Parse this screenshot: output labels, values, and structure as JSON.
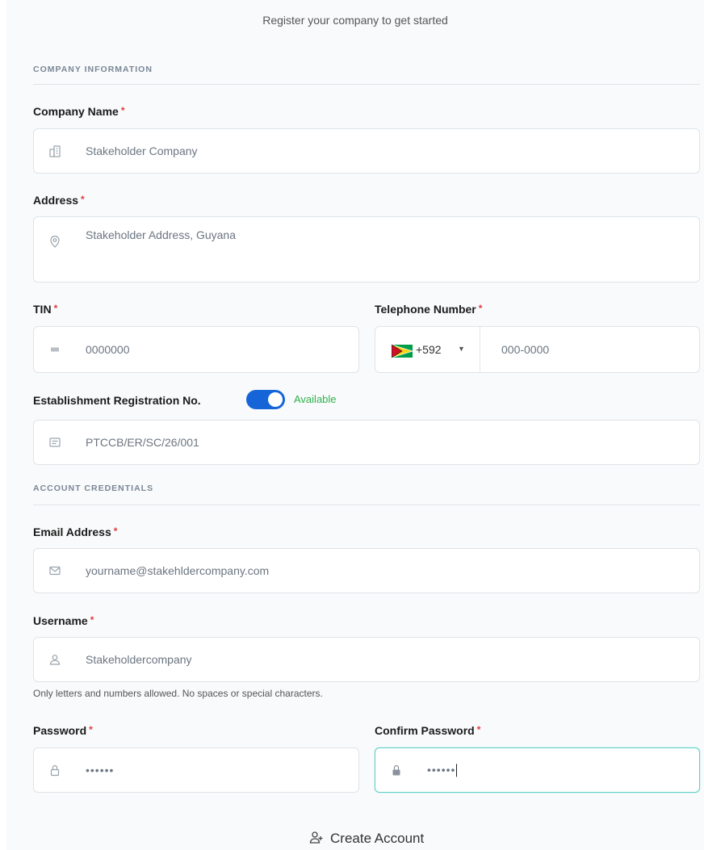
{
  "header": {
    "subtitle": "Register your company to get started"
  },
  "sections": {
    "company_info": "COMPANY INFORMATION",
    "credentials": "ACCOUNT CREDENTIALS"
  },
  "required_mark": "*",
  "fields": {
    "company_name": {
      "label": "Company Name",
      "value": "Stakeholder Company",
      "icon": "building-icon"
    },
    "address": {
      "label": "Address",
      "value": "Stakeholder Address, Guyana",
      "icon": "location-pin-icon"
    },
    "tin": {
      "label": "TIN",
      "placeholder": "0000000",
      "icon": "id-card-icon"
    },
    "telephone": {
      "label": "Telephone Number",
      "country_code": "+592",
      "placeholder": "000-0000",
      "flag": "guyana-flag-icon"
    },
    "establishment": {
      "label": "Establishment Registration No.",
      "toggle_on": true,
      "toggle_status": "Available",
      "value": "PTCCB/ER/SC/26/001",
      "icon": "document-icon"
    },
    "email": {
      "label": "Email Address",
      "value": "yourname@stakehldercompany.com",
      "icon": "mail-icon"
    },
    "username": {
      "label": "Username",
      "value": "Stakeholdercompany",
      "icon": "user-icon",
      "hint": "Only letters and numbers allowed. No spaces or special characters."
    },
    "password": {
      "label": "Password",
      "value": "••••••",
      "icon": "lock-icon"
    },
    "confirm_password": {
      "label": "Confirm Password",
      "value": "••••••",
      "icon": "lock-filled-icon"
    }
  },
  "actions": {
    "create_account": "Create Account"
  },
  "colors": {
    "accent": "#1565d8",
    "available": "#2fb24a",
    "required": "#e23b3b",
    "focus": "#5fd0c7"
  }
}
